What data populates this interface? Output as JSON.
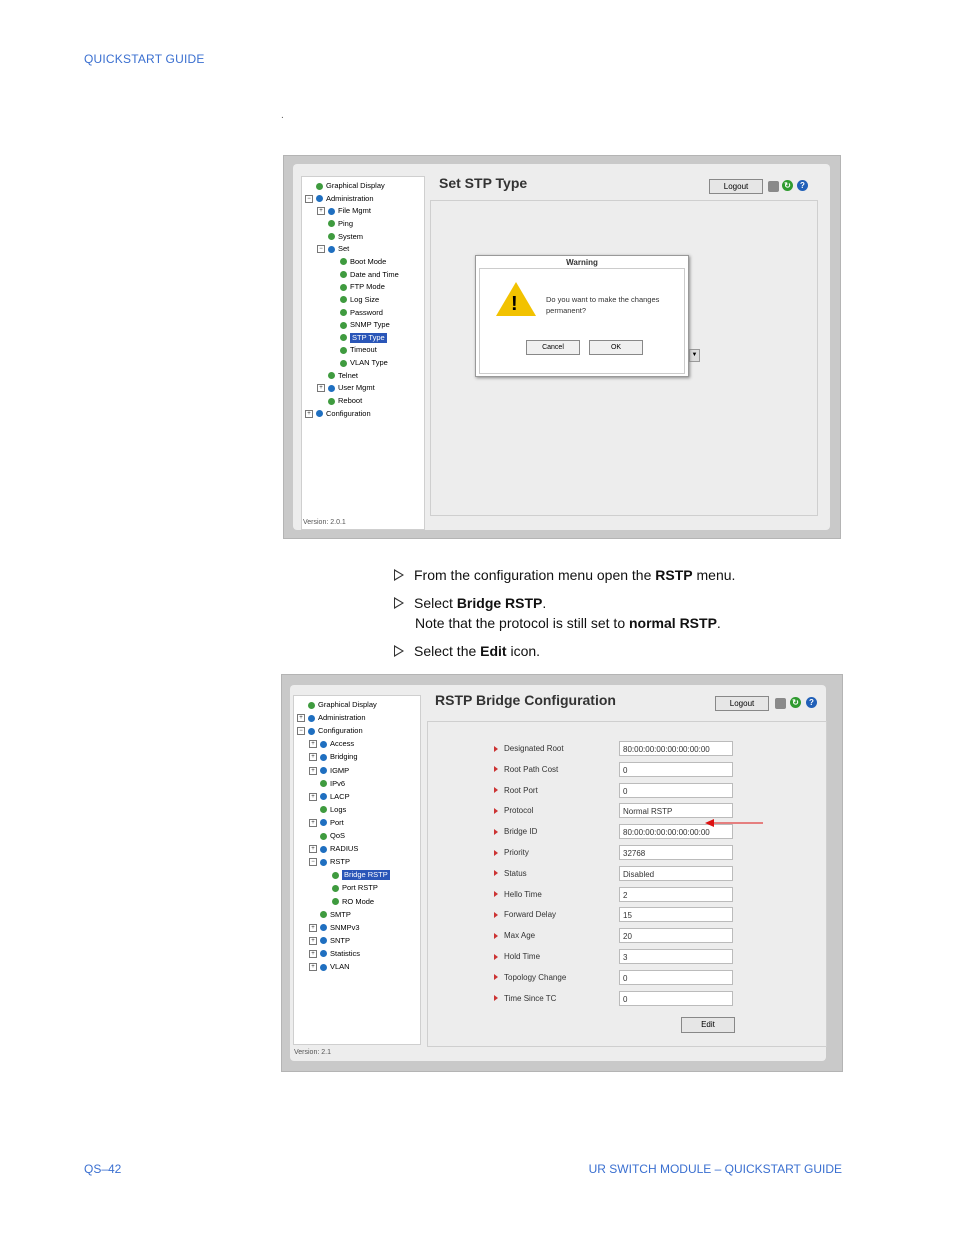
{
  "header": {
    "title": "QUICKSTART GUIDE"
  },
  "footer": {
    "page": "QS–42",
    "doc": "UR SWITCH MODULE – QUICKSTART GUIDE"
  },
  "stray_mark": ".",
  "shot1": {
    "title": "Set STP Type",
    "logout": "Logout",
    "version": "Version: 2.0.1",
    "tree": [
      {
        "label": "Graphical Display",
        "indent": 0,
        "pm": "",
        "dot": "g"
      },
      {
        "label": "Administration",
        "indent": 0,
        "pm": "−",
        "dot": "b"
      },
      {
        "label": "File Mgmt",
        "indent": 1,
        "pm": "+",
        "dot": "b"
      },
      {
        "label": "Ping",
        "indent": 1,
        "pm": "",
        "dot": "g"
      },
      {
        "label": "System",
        "indent": 1,
        "pm": "",
        "dot": "g"
      },
      {
        "label": "Set",
        "indent": 1,
        "pm": "−",
        "dot": "b"
      },
      {
        "label": "Boot Mode",
        "indent": 2,
        "pm": "",
        "dot": "g"
      },
      {
        "label": "Date and Time",
        "indent": 2,
        "pm": "",
        "dot": "g"
      },
      {
        "label": "FTP Mode",
        "indent": 2,
        "pm": "",
        "dot": "g"
      },
      {
        "label": "Log Size",
        "indent": 2,
        "pm": "",
        "dot": "g"
      },
      {
        "label": "Password",
        "indent": 2,
        "pm": "",
        "dot": "g"
      },
      {
        "label": "SNMP Type",
        "indent": 2,
        "pm": "",
        "dot": "g"
      },
      {
        "label": "STP Type",
        "indent": 2,
        "pm": "",
        "dot": "g",
        "selected": true
      },
      {
        "label": "Timeout",
        "indent": 2,
        "pm": "",
        "dot": "g"
      },
      {
        "label": "VLAN Type",
        "indent": 2,
        "pm": "",
        "dot": "g"
      },
      {
        "label": "Telnet",
        "indent": 1,
        "pm": "",
        "dot": "g"
      },
      {
        "label": "User Mgmt",
        "indent": 1,
        "pm": "+",
        "dot": "b"
      },
      {
        "label": "Reboot",
        "indent": 1,
        "pm": "",
        "dot": "g"
      },
      {
        "label": "Configuration",
        "indent": 0,
        "pm": "+",
        "dot": "b"
      }
    ],
    "dialog": {
      "title": "Warning",
      "message": "Do you want to make the changes  permanent?",
      "cancel": "Cancel",
      "ok": "OK"
    }
  },
  "instructions": {
    "step1": {
      "a": "From the configuration menu open the ",
      "b": "RSTP",
      "c": " menu."
    },
    "step2": {
      "a": "Select ",
      "b": "Bridge RSTP",
      "c": ".",
      "note_a": "Note that the protocol is still set to ",
      "note_b": "normal RSTP",
      "note_c": "."
    },
    "step3": {
      "a": "Select the ",
      "b": "Edit",
      "c": " icon."
    }
  },
  "shot2": {
    "title": "RSTP Bridge Configuration",
    "logout": "Logout",
    "version": "Version: 2.1",
    "edit": "Edit",
    "tree": [
      {
        "label": "Graphical Display",
        "indent": 0,
        "pm": "",
        "dot": "g"
      },
      {
        "label": "Administration",
        "indent": 0,
        "pm": "+",
        "dot": "b"
      },
      {
        "label": "Configuration",
        "indent": 0,
        "pm": "−",
        "dot": "b"
      },
      {
        "label": "Access",
        "indent": 1,
        "pm": "+",
        "dot": "b"
      },
      {
        "label": "Bridging",
        "indent": 1,
        "pm": "+",
        "dot": "b"
      },
      {
        "label": "IGMP",
        "indent": 1,
        "pm": "+",
        "dot": "b"
      },
      {
        "label": "IPv6",
        "indent": 1,
        "pm": "",
        "dot": "g"
      },
      {
        "label": "LACP",
        "indent": 1,
        "pm": "+",
        "dot": "b"
      },
      {
        "label": "Logs",
        "indent": 1,
        "pm": "",
        "dot": "g"
      },
      {
        "label": "Port",
        "indent": 1,
        "pm": "+",
        "dot": "b"
      },
      {
        "label": "QoS",
        "indent": 1,
        "pm": "",
        "dot": "g"
      },
      {
        "label": "RADIUS",
        "indent": 1,
        "pm": "+",
        "dot": "b"
      },
      {
        "label": "RSTP",
        "indent": 1,
        "pm": "−",
        "dot": "b"
      },
      {
        "label": "Bridge RSTP",
        "indent": 2,
        "pm": "",
        "dot": "g",
        "selected": true
      },
      {
        "label": "Port RSTP",
        "indent": 2,
        "pm": "",
        "dot": "g"
      },
      {
        "label": "RO Mode",
        "indent": 2,
        "pm": "",
        "dot": "g"
      },
      {
        "label": "SMTP",
        "indent": 1,
        "pm": "",
        "dot": "g"
      },
      {
        "label": "SNMPv3",
        "indent": 1,
        "pm": "+",
        "dot": "b"
      },
      {
        "label": "SNTP",
        "indent": 1,
        "pm": "+",
        "dot": "b"
      },
      {
        "label": "Statistics",
        "indent": 1,
        "pm": "+",
        "dot": "b"
      },
      {
        "label": "VLAN",
        "indent": 1,
        "pm": "+",
        "dot": "b"
      }
    ],
    "fields": [
      {
        "label": "Designated Root",
        "value": "80:00:00:00:00:00:00:00"
      },
      {
        "label": "Root Path Cost",
        "value": "0"
      },
      {
        "label": "Root Port",
        "value": "0"
      },
      {
        "label": "Protocol",
        "value": "Normal RSTP"
      },
      {
        "label": "Bridge ID",
        "value": "80:00:00:00:00:00:00:00"
      },
      {
        "label": "Priority",
        "value": "32768"
      },
      {
        "label": "Status",
        "value": "Disabled"
      },
      {
        "label": "Hello Time",
        "value": "2"
      },
      {
        "label": "Forward Delay",
        "value": "15"
      },
      {
        "label": "Max Age",
        "value": "20"
      },
      {
        "label": "Hold Time",
        "value": "3"
      },
      {
        "label": "Topology Change",
        "value": "0"
      },
      {
        "label": "Time Since TC",
        "value": "0"
      }
    ]
  }
}
